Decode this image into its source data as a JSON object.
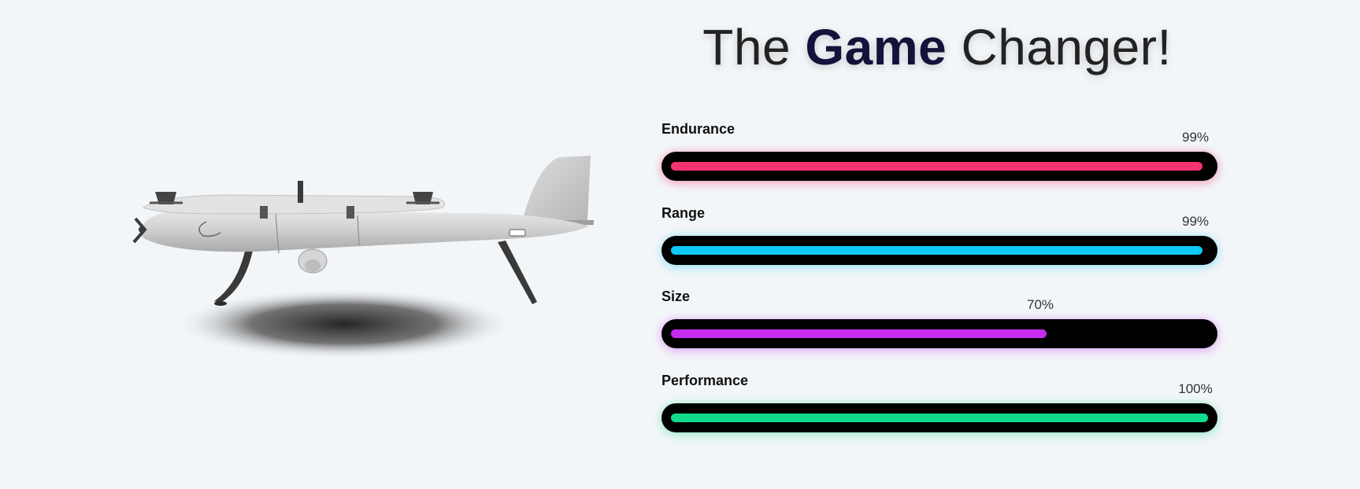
{
  "headline": {
    "before": "The ",
    "accent": "Game",
    "after": " Changer!"
  },
  "product_image": {
    "icon": "vtol-drone-illustration"
  },
  "skills": [
    {
      "label": "Endurance",
      "value": 99,
      "value_text": "99%",
      "color": "#f4336f",
      "glow": "rgba(244,51,111,0.28)"
    },
    {
      "label": "Range",
      "value": 99,
      "value_text": "99%",
      "color": "#10c8f5",
      "glow": "rgba(16,200,245,0.25)"
    },
    {
      "label": "Size",
      "value": 70,
      "value_text": "70%",
      "color": "#c52cf0",
      "glow": "rgba(197,44,240,0.25)"
    },
    {
      "label": "Performance",
      "value": 100,
      "value_text": "100%",
      "color": "#10dc8c",
      "glow": "rgba(16,220,140,0.25)"
    }
  ]
}
